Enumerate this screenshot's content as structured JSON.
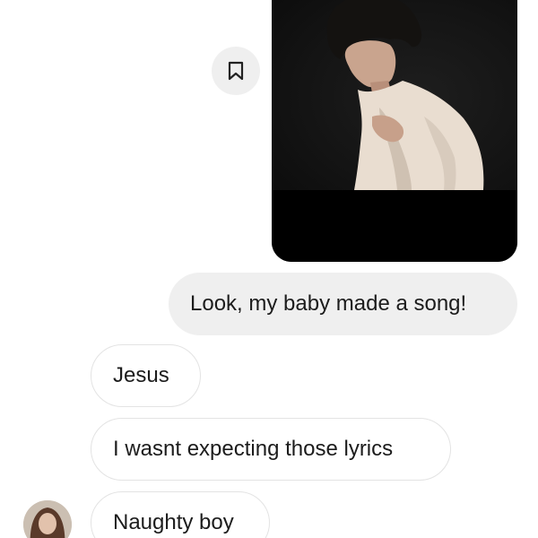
{
  "conversation": {
    "shared_media": {
      "thumbnail": "man-in-cream-shirt-video-thumbnail",
      "save_icon": "bookmark-icon",
      "background_color": "#000000"
    },
    "messages": [
      {
        "direction": "sent",
        "text": "Look, my baby made a song!"
      },
      {
        "direction": "received",
        "text": "Jesus"
      },
      {
        "direction": "received",
        "text": "I wasnt expecting those lyrics"
      },
      {
        "direction": "received",
        "text": "Naughty boy"
      }
    ],
    "sender_avatar": "profile-photo-avatar"
  },
  "colors": {
    "sent_bubble": "#efefef",
    "received_border": "#e3e3e3",
    "text": "#1c1c1c"
  }
}
